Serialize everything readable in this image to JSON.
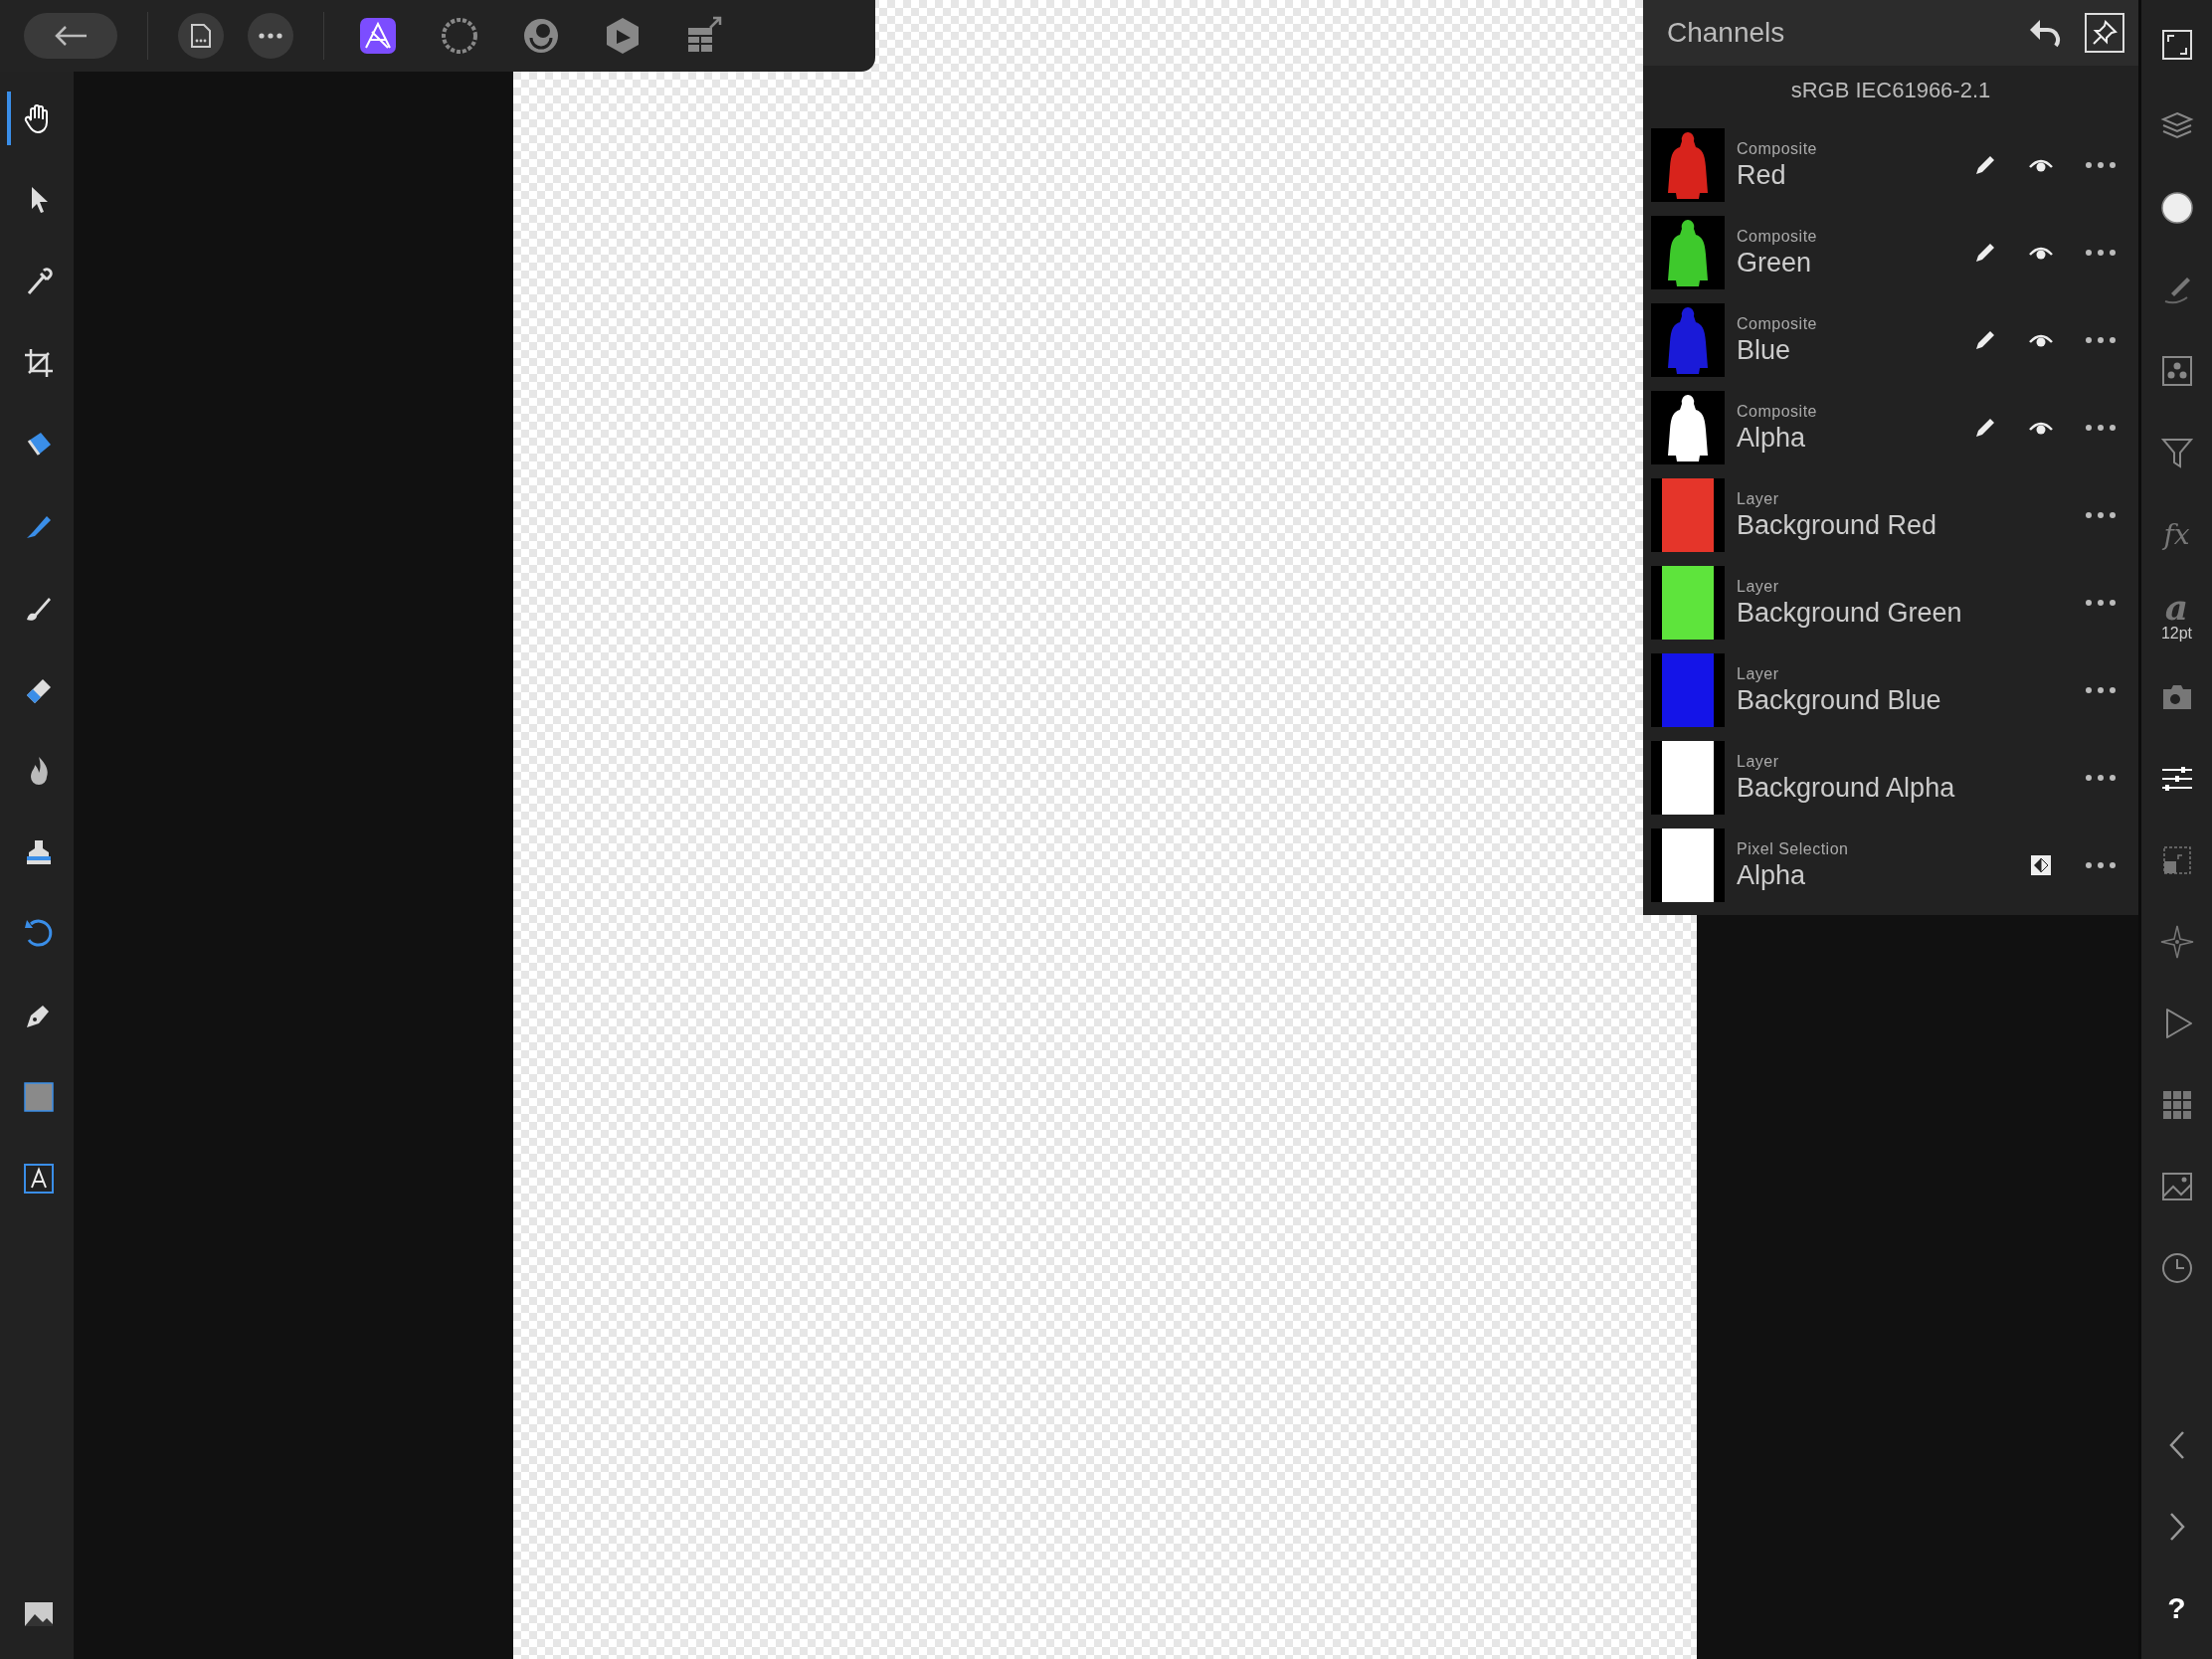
{
  "top_bar": {
    "buttons": [
      {
        "kind": "back"
      },
      {
        "kind": "document"
      },
      {
        "kind": "more"
      }
    ],
    "personas": [
      {
        "kind": "photo",
        "selected": true
      },
      {
        "kind": "liquify",
        "selected": false
      },
      {
        "kind": "develop",
        "selected": false
      },
      {
        "kind": "tone",
        "selected": false
      },
      {
        "kind": "export",
        "selected": false
      }
    ]
  },
  "tools": [
    {
      "kind": "hand",
      "selected": true
    },
    {
      "kind": "move",
      "selected": false
    },
    {
      "kind": "picker",
      "selected": false
    },
    {
      "kind": "crop",
      "selected": false
    },
    {
      "kind": "fill",
      "selected": false
    },
    {
      "kind": "selbrush",
      "selected": false
    },
    {
      "kind": "brush",
      "selected": false
    },
    {
      "kind": "eraser",
      "selected": false
    },
    {
      "kind": "burn",
      "selected": false
    },
    {
      "kind": "stamp",
      "selected": false
    },
    {
      "kind": "undo",
      "selected": false
    },
    {
      "kind": "pen",
      "selected": false
    },
    {
      "kind": "shape",
      "selected": false
    },
    {
      "kind": "text",
      "selected": false
    },
    {
      "kind": "quickmask",
      "selected": false
    }
  ],
  "channels_panel": {
    "title": "Channels",
    "profile": "sRGB IEC61966-2.1",
    "rows": [
      {
        "kind": "composite",
        "type": "Composite",
        "name": "Red",
        "color": "#d8231c"
      },
      {
        "kind": "composite",
        "type": "Composite",
        "name": "Green",
        "color": "#3ec92c"
      },
      {
        "kind": "composite",
        "type": "Composite",
        "name": "Blue",
        "color": "#1a1ad8"
      },
      {
        "kind": "composite",
        "type": "Composite",
        "name": "Alpha",
        "color": "#ffffff"
      },
      {
        "kind": "layer",
        "type": "Layer",
        "name": "Background Red",
        "color": "#e5352a"
      },
      {
        "kind": "layer",
        "type": "Layer",
        "name": "Background Green",
        "color": "#5ee43c"
      },
      {
        "kind": "layer",
        "type": "Layer",
        "name": "Background Blue",
        "color": "#1414e8"
      },
      {
        "kind": "layer",
        "type": "Layer",
        "name": "Background Alpha",
        "color": "#ffffff"
      },
      {
        "kind": "selection",
        "type": "Pixel Selection",
        "name": "Alpha",
        "color": "#ffffff"
      }
    ]
  },
  "studio_bar": [
    {
      "kind": "fullscreen",
      "selected": false
    },
    {
      "kind": "layers",
      "selected": false
    },
    {
      "kind": "color",
      "selected": false
    },
    {
      "kind": "brushes",
      "selected": false
    },
    {
      "kind": "channels",
      "selected": false
    },
    {
      "kind": "filter",
      "selected": false
    },
    {
      "kind": "fx",
      "glyph": "fx",
      "selected": false
    },
    {
      "kind": "textstyle",
      "glyph": "a",
      "caption": "12pt",
      "selected": false
    },
    {
      "kind": "camera",
      "selected": false
    },
    {
      "kind": "adjust",
      "selected": true
    },
    {
      "kind": "transform",
      "selected": false
    },
    {
      "kind": "navigator",
      "selected": false
    },
    {
      "kind": "macro",
      "selected": false
    },
    {
      "kind": "grid",
      "selected": false
    },
    {
      "kind": "stock",
      "selected": false
    },
    {
      "kind": "history",
      "selected": false
    }
  ],
  "studio_footer": [
    {
      "kind": "prev"
    },
    {
      "kind": "next"
    },
    {
      "kind": "help",
      "glyph": "?"
    }
  ]
}
